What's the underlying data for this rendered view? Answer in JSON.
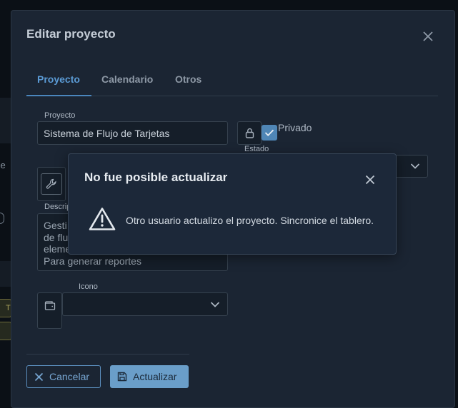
{
  "background": {
    "partial_text": "arje",
    "chip_text": "T"
  },
  "dialog": {
    "title": "Editar proyecto",
    "tabs": [
      {
        "label": "Proyecto",
        "active": true
      },
      {
        "label": "Calendario",
        "active": false
      },
      {
        "label": "Otros",
        "active": false
      }
    ],
    "fields": {
      "project_label": "Proyecto",
      "project_value": "Sistema de Flujo de Tarjetas",
      "private_label": "Privado",
      "private_checked": true,
      "state_label": "Estado",
      "description_label": "Descripción",
      "description_visible_lines": [
        "Gesti",
        "de flu",
        "eleme",
        "Para generar reportes"
      ],
      "icon_label": "Icono"
    },
    "buttons": {
      "cancel": "Cancelar",
      "update": "Actualizar"
    }
  },
  "alert": {
    "title": "No fue posible actualizar",
    "message": "Otro usuario actualizo el proyecto. Sincronice el tablero.",
    "icon": "warning-icon"
  },
  "colors": {
    "accent": "#5b9bd5",
    "dialog_bg": "#1b2533",
    "alert_bg": "#1c2839",
    "primary_button": "#6a9ec9"
  }
}
